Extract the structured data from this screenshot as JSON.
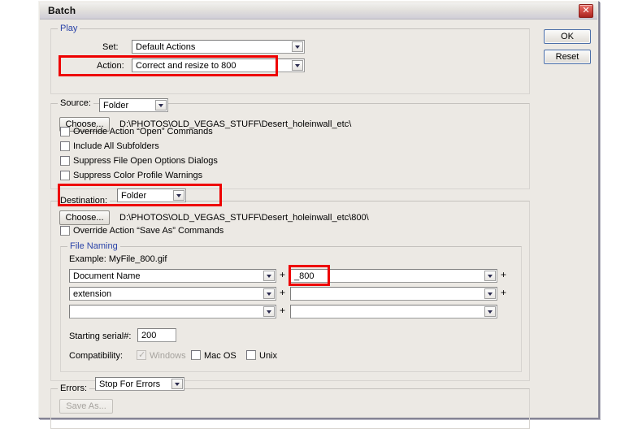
{
  "window": {
    "title": "Batch",
    "close_icon": "close-icon"
  },
  "buttons": {
    "ok": "OK",
    "reset": "Reset"
  },
  "play": {
    "legend": "Play",
    "set_label": "Set:",
    "set_value": "Default Actions",
    "action_label": "Action:",
    "action_value": "Correct and resize to 800"
  },
  "source": {
    "legend": "Source:",
    "value": "Folder",
    "choose_label": "Choose...",
    "path": "D:\\PHOTOS\\OLD_VEGAS_STUFF\\Desert_holeinwall_etc\\",
    "checkboxes": [
      {
        "label": "Override Action “Open” Commands",
        "checked": false
      },
      {
        "label": "Include All Subfolders",
        "checked": false
      },
      {
        "label": "Suppress File Open Options Dialogs",
        "checked": false
      },
      {
        "label": "Suppress Color Profile Warnings",
        "checked": false
      }
    ]
  },
  "destination": {
    "legend": "Destination:",
    "value": "Folder",
    "choose_label": "Choose...",
    "path": "D:\\PHOTOS\\OLD_VEGAS_STUFF\\Desert_holeinwall_etc\\800\\",
    "override_label": "Override Action “Save As” Commands",
    "override_checked": false
  },
  "file_naming": {
    "legend": "File Naming",
    "example_label": "Example: MyFile_800.gif",
    "rows": [
      {
        "left_value": "Document Name",
        "right_value": "_800",
        "plus": "+",
        "trailing_plus": "+"
      },
      {
        "left_value": "extension",
        "right_value": "",
        "plus": "+",
        "trailing_plus": "+"
      },
      {
        "left_value": "",
        "right_value": "",
        "plus": "+",
        "trailing_plus": ""
      }
    ],
    "serial_label": "Starting serial#:",
    "serial_value": "200",
    "compatibility_label": "Compatibility:",
    "compatibility": [
      {
        "label": "Windows",
        "checked": true,
        "disabled": true
      },
      {
        "label": "Mac OS",
        "checked": false,
        "disabled": false
      },
      {
        "label": "Unix",
        "checked": false,
        "disabled": false
      }
    ]
  },
  "errors": {
    "legend": "Errors:",
    "value": "Stop For Errors",
    "save_as_label": "Save As..."
  },
  "colors": {
    "highlight": "#ee0000",
    "legend_blue": "#22379c",
    "dialog_bg": "#ece9e4"
  }
}
